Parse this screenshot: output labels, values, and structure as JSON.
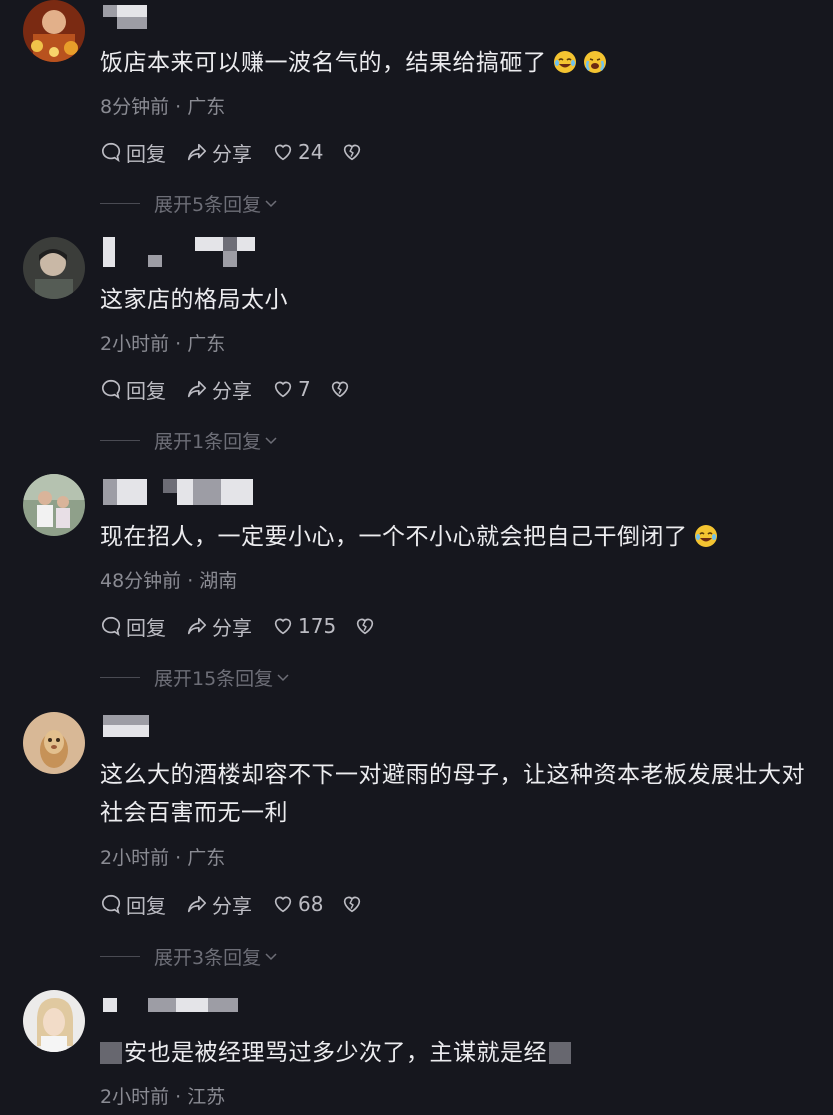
{
  "actions": {
    "reply": "回复",
    "share": "分享"
  },
  "comments": [
    {
      "text_pre": "饭店本来可以赚一波名气的，结果给搞砸了",
      "meta": "8分钟前 · 广东",
      "likes": "24",
      "expand": "展开5条回复"
    },
    {
      "text": "这家店的格局太小",
      "meta": "2小时前 · 广东",
      "likes": "7",
      "expand": "展开1条回复"
    },
    {
      "text": "现在招人，一定要小心，一个不小心就会把自己干倒闭了",
      "meta": "48分钟前 · 湖南",
      "likes": "175",
      "expand": "展开15条回复"
    },
    {
      "text": "这么大的酒楼却容不下一对避雨的母子，让这种资本老板发展壮大对社会百害而无一利",
      "meta": "2小时前 · 广东",
      "likes": "68",
      "expand": "展开3条回复"
    },
    {
      "text_mid": "安也是被经理骂过多少次了，主谋就是经",
      "meta": "2小时前 · 江苏"
    }
  ],
  "icons": [
    "reply-icon",
    "share-icon",
    "heart-icon",
    "broken-heart-icon",
    "chevron-down-icon"
  ]
}
